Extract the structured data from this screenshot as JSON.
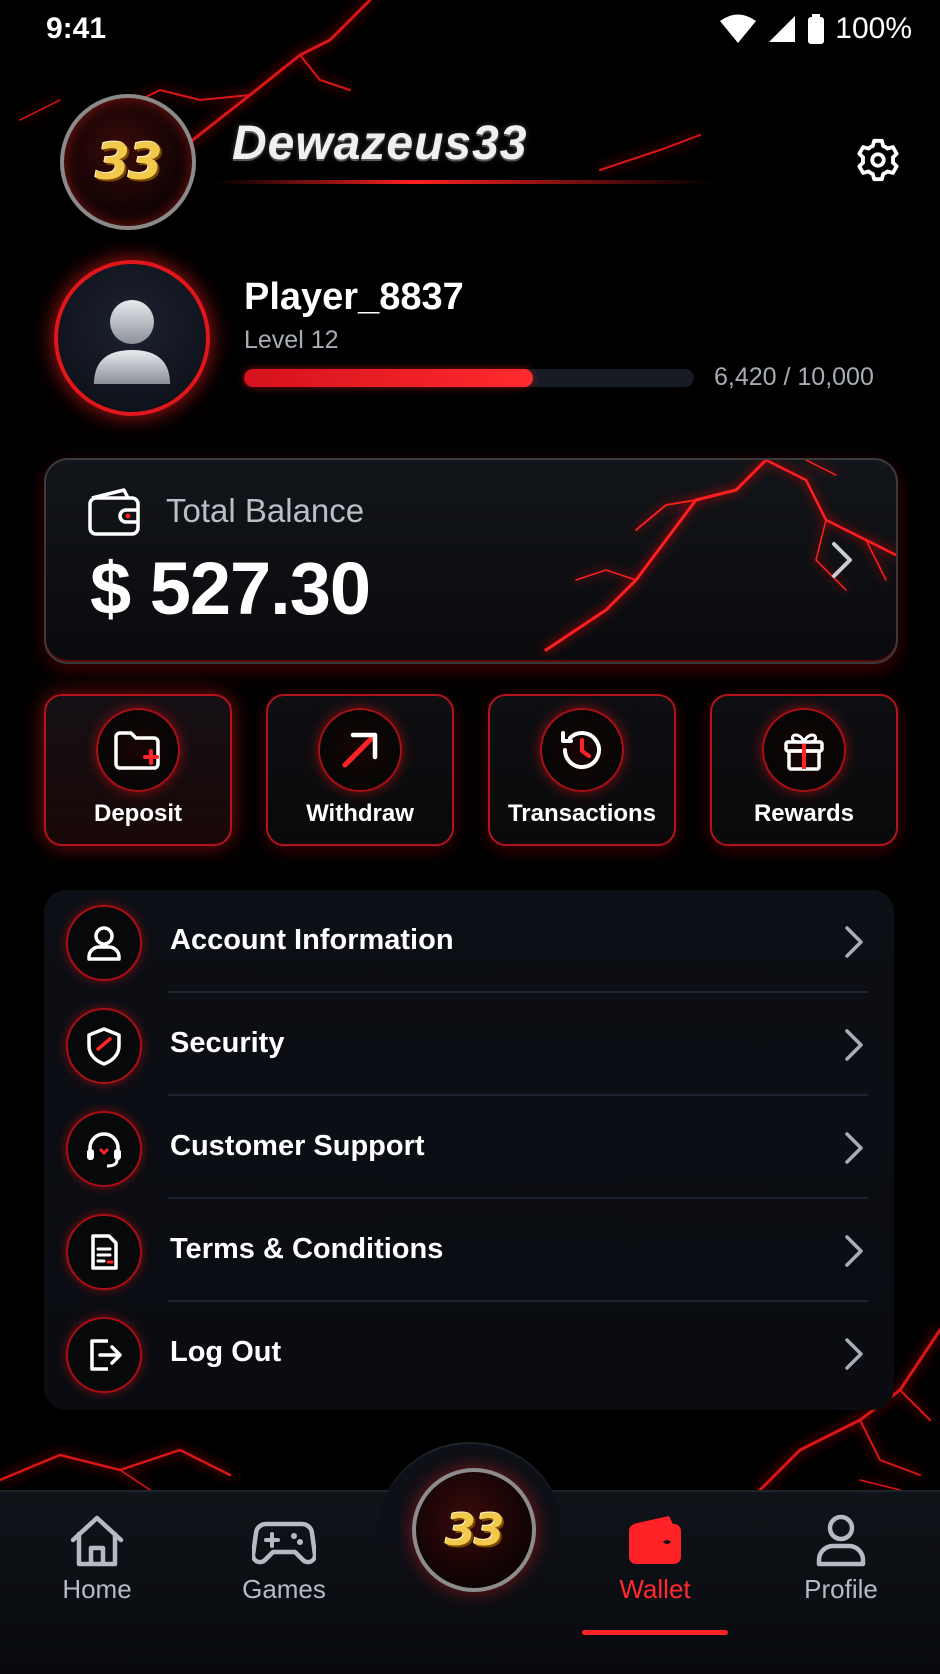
{
  "status_bar": {
    "time": "9:41",
    "battery": "100%"
  },
  "header": {
    "logo_text": "33",
    "brand": "Dewazeus33"
  },
  "profile": {
    "name": "Player_8837",
    "level": "Level 12",
    "xp_text": "6,420 / 10,000",
    "xp_progress": 0.642
  },
  "balance": {
    "label": "Total Balance",
    "value": "$ 527.30"
  },
  "actions": [
    {
      "label": "Deposit",
      "icon": "folder-add-icon"
    },
    {
      "label": "Withdraw",
      "icon": "arrow-up-right-icon"
    },
    {
      "label": "Transactions",
      "icon": "history-clock-icon"
    },
    {
      "label": "Rewards",
      "icon": "gift-icon"
    }
  ],
  "menu": [
    {
      "label": "Account Information",
      "icon": "user-icon"
    },
    {
      "label": "Security",
      "icon": "shield-icon"
    },
    {
      "label": "Customer Support",
      "icon": "headset-icon"
    },
    {
      "label": "Terms & Conditions",
      "icon": "document-icon"
    },
    {
      "label": "Log Out",
      "icon": "logout-icon"
    }
  ],
  "bottom_nav": {
    "items": [
      {
        "label": "Home",
        "icon": "home-icon"
      },
      {
        "label": "Games",
        "icon": "gamepad-icon"
      },
      {
        "label": "Wallet",
        "icon": "wallet-icon",
        "active": true
      },
      {
        "label": "Profile",
        "icon": "profile-icon"
      }
    ],
    "center_logo": "33"
  },
  "colors": {
    "accent": "#ff2226",
    "background": "#000000",
    "card": "#0c0f15",
    "muted_text": "#a7acb6"
  }
}
